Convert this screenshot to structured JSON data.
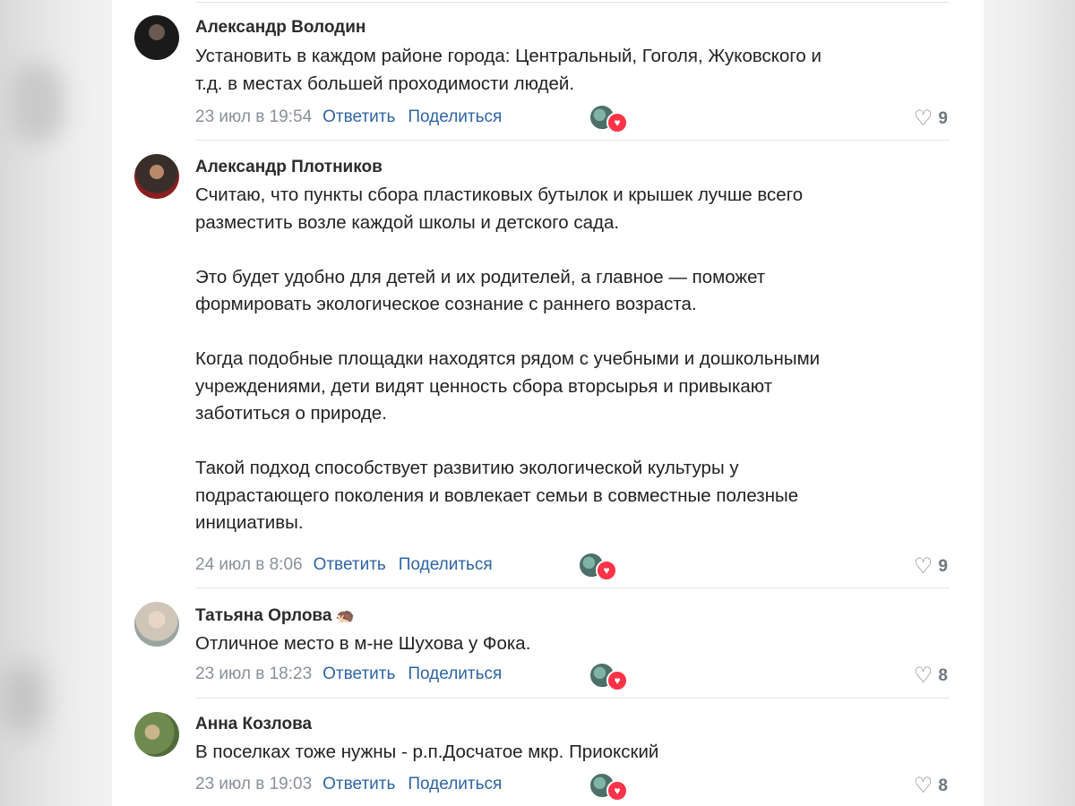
{
  "comments": [
    {
      "author": "Александр Володин",
      "emoji": "",
      "text": "Установить в каждом районе города: Центральный, Гоголя, Жуковского и\nт.д. в местах большей проходимости людей.",
      "date": "23 июл в 19:54",
      "reply": "Ответить",
      "share": "Поделиться",
      "likes": "9",
      "avatar_icon": "user-avatar"
    },
    {
      "author": "Александр Плотников",
      "emoji": "",
      "text": "Считаю, что пункты сбора пластиковых бутылок и крышек лучше всего\nразместить возле каждой школы и детского сада.\n\nЭто будет удобно для детей и их родителей, а главное — поможет\nформировать экологическое сознание с раннего возраста.\n\nКогда подобные площадки находятся рядом с учебными и дошкольными\nучреждениями, дети видят ценность сбора вторсырья и привыкают\nзаботиться о природе.\n\nТакой подход способствует развитию экологической культуры у\nподрастающего поколения и вовлекает семьи в совместные полезные\nинициативы.",
      "date": "24 июл в 8:06",
      "reply": "Ответить",
      "share": "Поделиться",
      "likes": "9",
      "avatar_icon": "user-avatar"
    },
    {
      "author": "Татьяна Орлова",
      "emoji": "🦔",
      "text": "Отличное место в м-не Шухова у Фока.",
      "date": "23 июл в 18:23",
      "reply": "Ответить",
      "share": "Поделиться",
      "likes": "8",
      "avatar_icon": "user-avatar"
    },
    {
      "author": "Анна Козлова",
      "emoji": "",
      "text": "В поселках тоже нужны - р.п.Досчатое мкр. Приокский",
      "date": "23 июл в 19:03",
      "reply": "Ответить",
      "share": "Поделиться",
      "likes": "8",
      "avatar_icon": "user-avatar"
    }
  ],
  "colors": {
    "link": "#2d64a4",
    "meta": "#8a8f98",
    "reaction_heart": "#ff3347"
  },
  "icons": {
    "like": "heart-outline-icon",
    "reaction": "heart-reaction-icon"
  }
}
